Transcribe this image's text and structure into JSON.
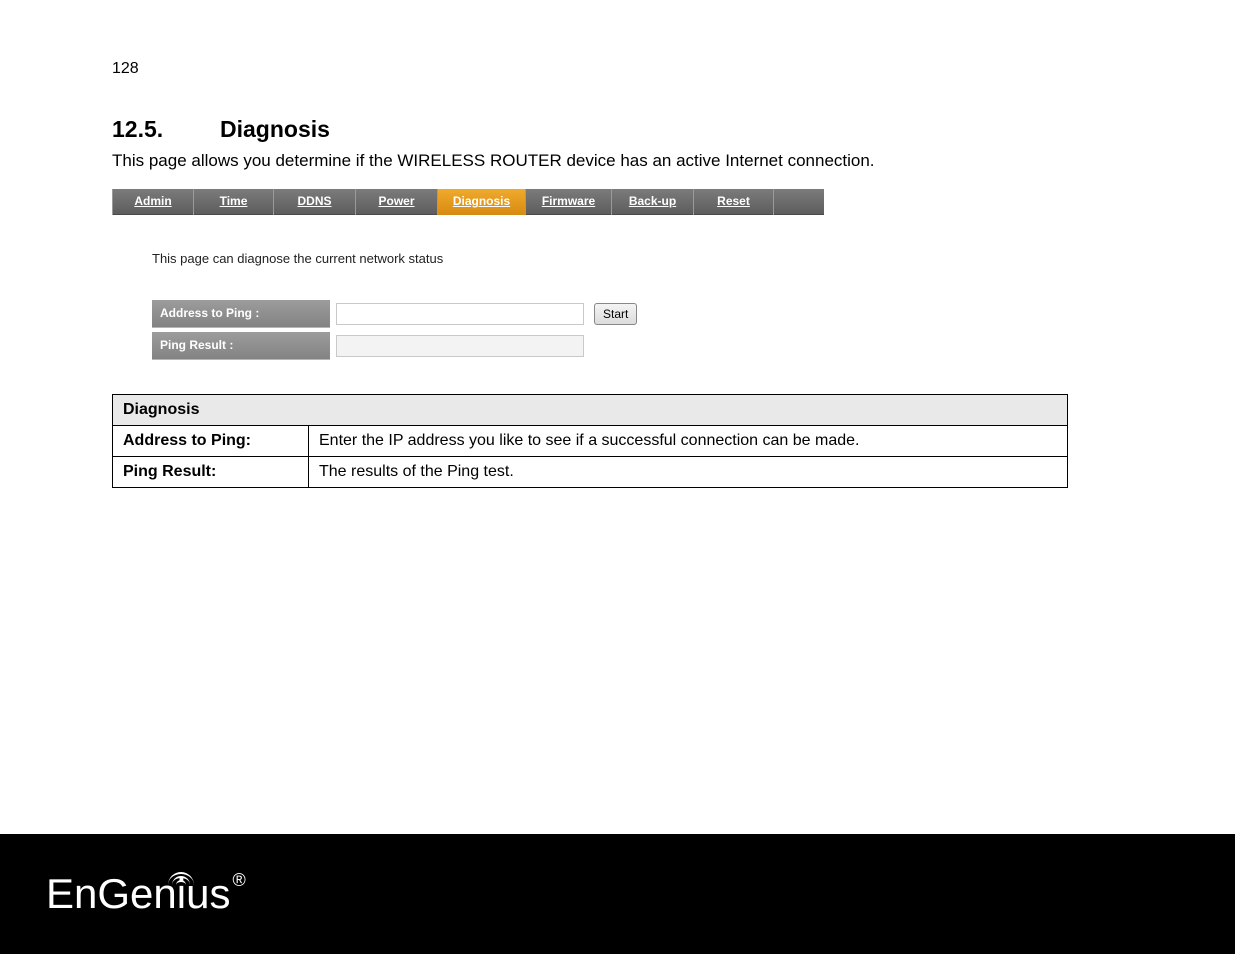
{
  "page_number": "128",
  "section": {
    "number": "12.5.",
    "title": "Diagnosis"
  },
  "intro": "This page allows you determine if the WIRELESS ROUTER device has an active Internet connection.",
  "screenshot": {
    "tabs": [
      {
        "label": "Admin",
        "active": false
      },
      {
        "label": "Time",
        "active": false
      },
      {
        "label": "DDNS",
        "active": false
      },
      {
        "label": "Power",
        "active": false
      },
      {
        "label": "Diagnosis",
        "active": true
      },
      {
        "label": "Firmware",
        "active": false
      },
      {
        "label": "Back-up",
        "active": false
      },
      {
        "label": "Reset",
        "active": false
      }
    ],
    "description": "This page can diagnose the current network status",
    "form": {
      "address_label": "Address to Ping :",
      "address_value": "",
      "start_button": "Start",
      "result_label": "Ping Result :",
      "result_value": ""
    }
  },
  "table": {
    "header": "Diagnosis",
    "rows": [
      {
        "label": "Address to Ping:",
        "desc": "Enter the IP address you like to see if a successful connection can be made."
      },
      {
        "label": "Ping Result:",
        "desc": "The results of the Ping test."
      }
    ]
  },
  "footer": {
    "brand": "EnGenius",
    "registered": "®"
  }
}
